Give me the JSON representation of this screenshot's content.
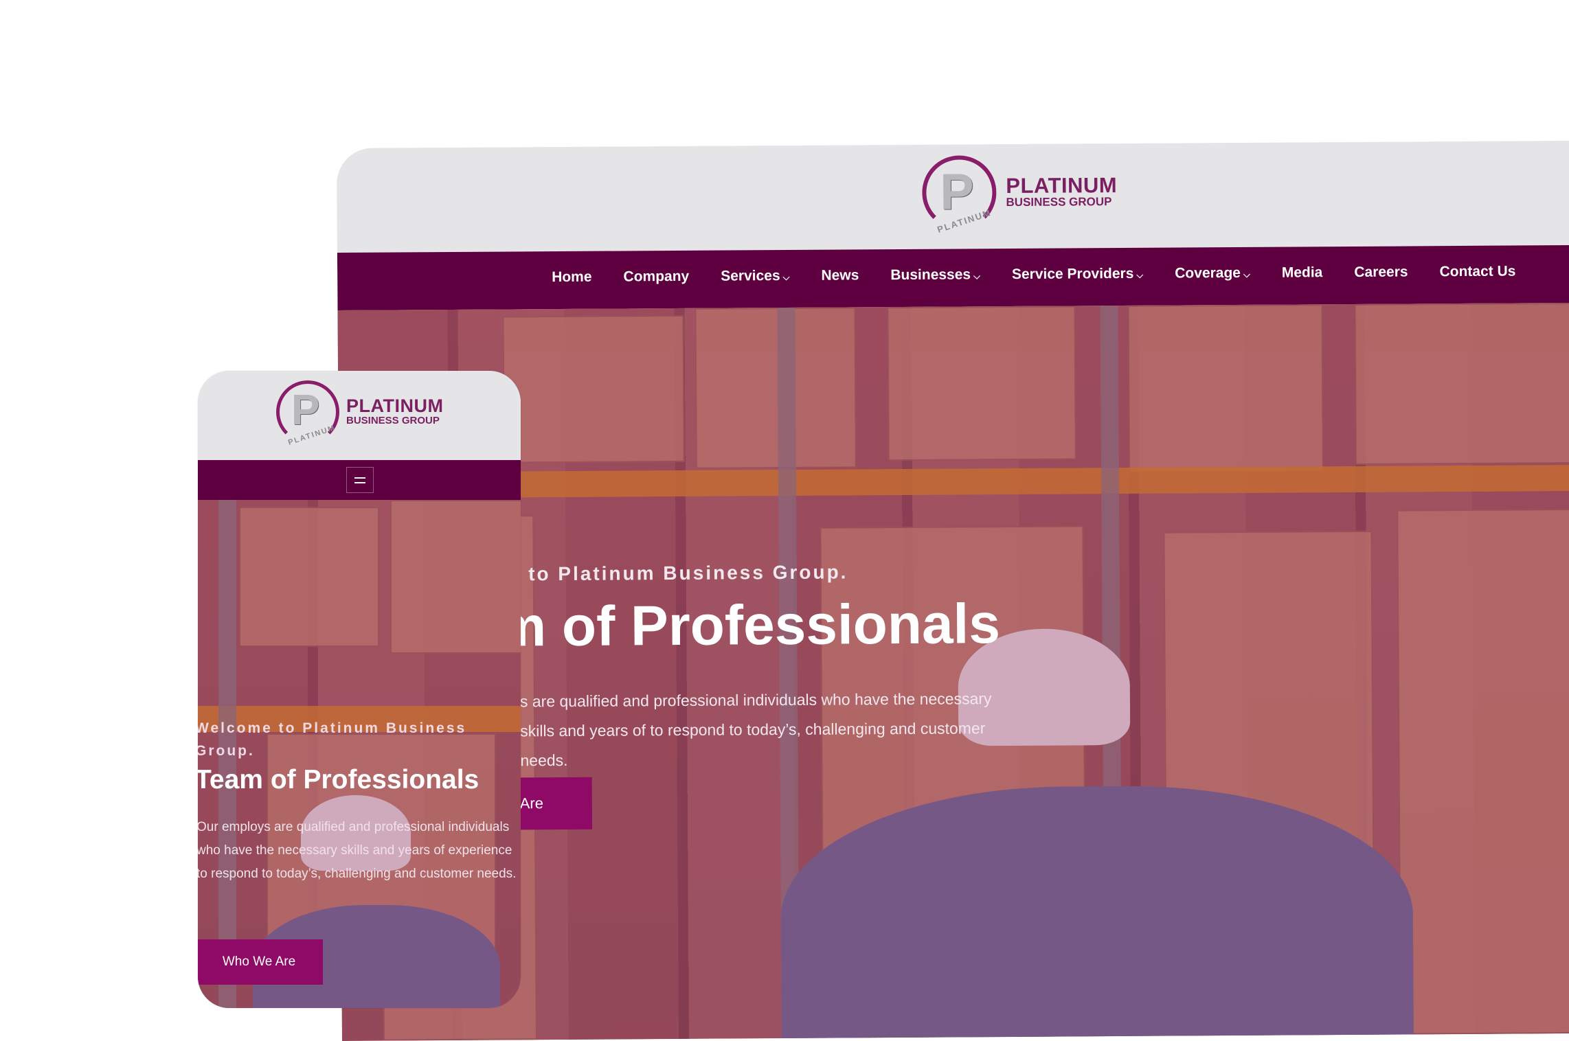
{
  "brand": {
    "name_line1": "PLATINUM",
    "name_line2": "BUSINESS GROUP",
    "mark_letter": "P",
    "mark_arc_text": "PLATINUM",
    "color_primary": "#5e0040",
    "color_accent": "#8e0a66"
  },
  "desktop": {
    "nav": {
      "items": [
        {
          "label": "Home",
          "has_dropdown": false
        },
        {
          "label": "Company",
          "has_dropdown": false
        },
        {
          "label": "Services",
          "has_dropdown": true
        },
        {
          "label": "News",
          "has_dropdown": false
        },
        {
          "label": "Businesses",
          "has_dropdown": true
        },
        {
          "label": "Service Providers",
          "has_dropdown": true
        },
        {
          "label": "Coverage",
          "has_dropdown": true
        },
        {
          "label": "Media",
          "has_dropdown": false
        },
        {
          "label": "Careers",
          "has_dropdown": false
        },
        {
          "label": "Contact Us",
          "has_dropdown": false
        }
      ],
      "chevron_glyph": "⌵"
    },
    "hero": {
      "kicker": "e to Platinum Business Group.",
      "title": "m of Professionals",
      "copy": "s are qualified and professional individuals who have the necessary skills and years of to respond to today’s, challenging and customer needs.",
      "button_label": "Are"
    }
  },
  "mobile": {
    "menu_icon": "hamburger-icon",
    "hero": {
      "kicker": "Welcome to Platinum Business Group.",
      "title": "Team of Professionals",
      "copy": "Our employs are qualified and professional individuals who have the necessary skills and years of experience to respond to today’s, challenging and customer needs.",
      "button_label": "Who We Are"
    }
  }
}
